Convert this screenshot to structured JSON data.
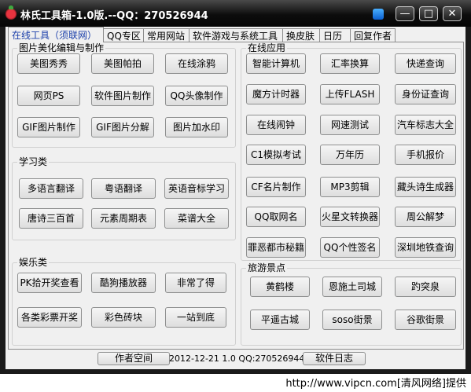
{
  "window": {
    "title": "林氏工具箱-1.0版.--QQ：270526944",
    "buttons": {
      "minimize": "—",
      "maximize": "□",
      "close": "✕"
    }
  },
  "tabs": [
    "在线工具（须联网）",
    "QQ专区",
    "常用网站",
    "软件游戏与系统工具",
    "换皮肤",
    "日历",
    "回复作者"
  ],
  "groups": {
    "image": {
      "title": "图片美化编辑与制作",
      "buttons": [
        "美图秀秀",
        "美图帕拍",
        "在线涂鸦",
        "网页PS",
        "软件图片制作",
        "QQ头像制作",
        "GIF图片制作",
        "GIF图片分解",
        "图片加水印"
      ]
    },
    "study": {
      "title": "学习类",
      "buttons": [
        "多语言翻译",
        "粤语翻译",
        "英语音标学习",
        "唐诗三百首",
        "元素周期表",
        "菜谱大全"
      ]
    },
    "fun": {
      "title": "娱乐类",
      "buttons": [
        "PK拾开奖查看",
        "酷狗播放器",
        "非常了得",
        "各类彩票开奖",
        "彩色砖块",
        "一站到底"
      ]
    },
    "apps": {
      "title": "在线应用",
      "buttons": [
        "智能计算机",
        "汇率换算",
        "快递查询",
        "魔方计时器",
        "上传FLASH",
        "身份证查询",
        "在线闹钟",
        "网速测试",
        "汽车标志大全",
        "C1模拟考试",
        "万年历",
        "手机报价",
        "CF名片制作",
        "MP3剪辑",
        "藏头诗生成器",
        "QQ取网名",
        "火星文转换器",
        "周公解梦",
        "罪恶都市秘籍",
        "QQ个性签名",
        "深圳地铁查询"
      ]
    },
    "travel": {
      "title": "旅游景点",
      "buttons": [
        "黄鹤楼",
        "恩施土司城",
        "趵突泉",
        "平遥古城",
        "soso街景",
        "谷歌街景"
      ]
    }
  },
  "statusbar": {
    "author_button": "作者空间",
    "info": "2012-12-21 1.0 QQ:270526944",
    "log_button": "软件日志"
  },
  "watermark": "http://www.vipcn.com[清风网络]提供"
}
